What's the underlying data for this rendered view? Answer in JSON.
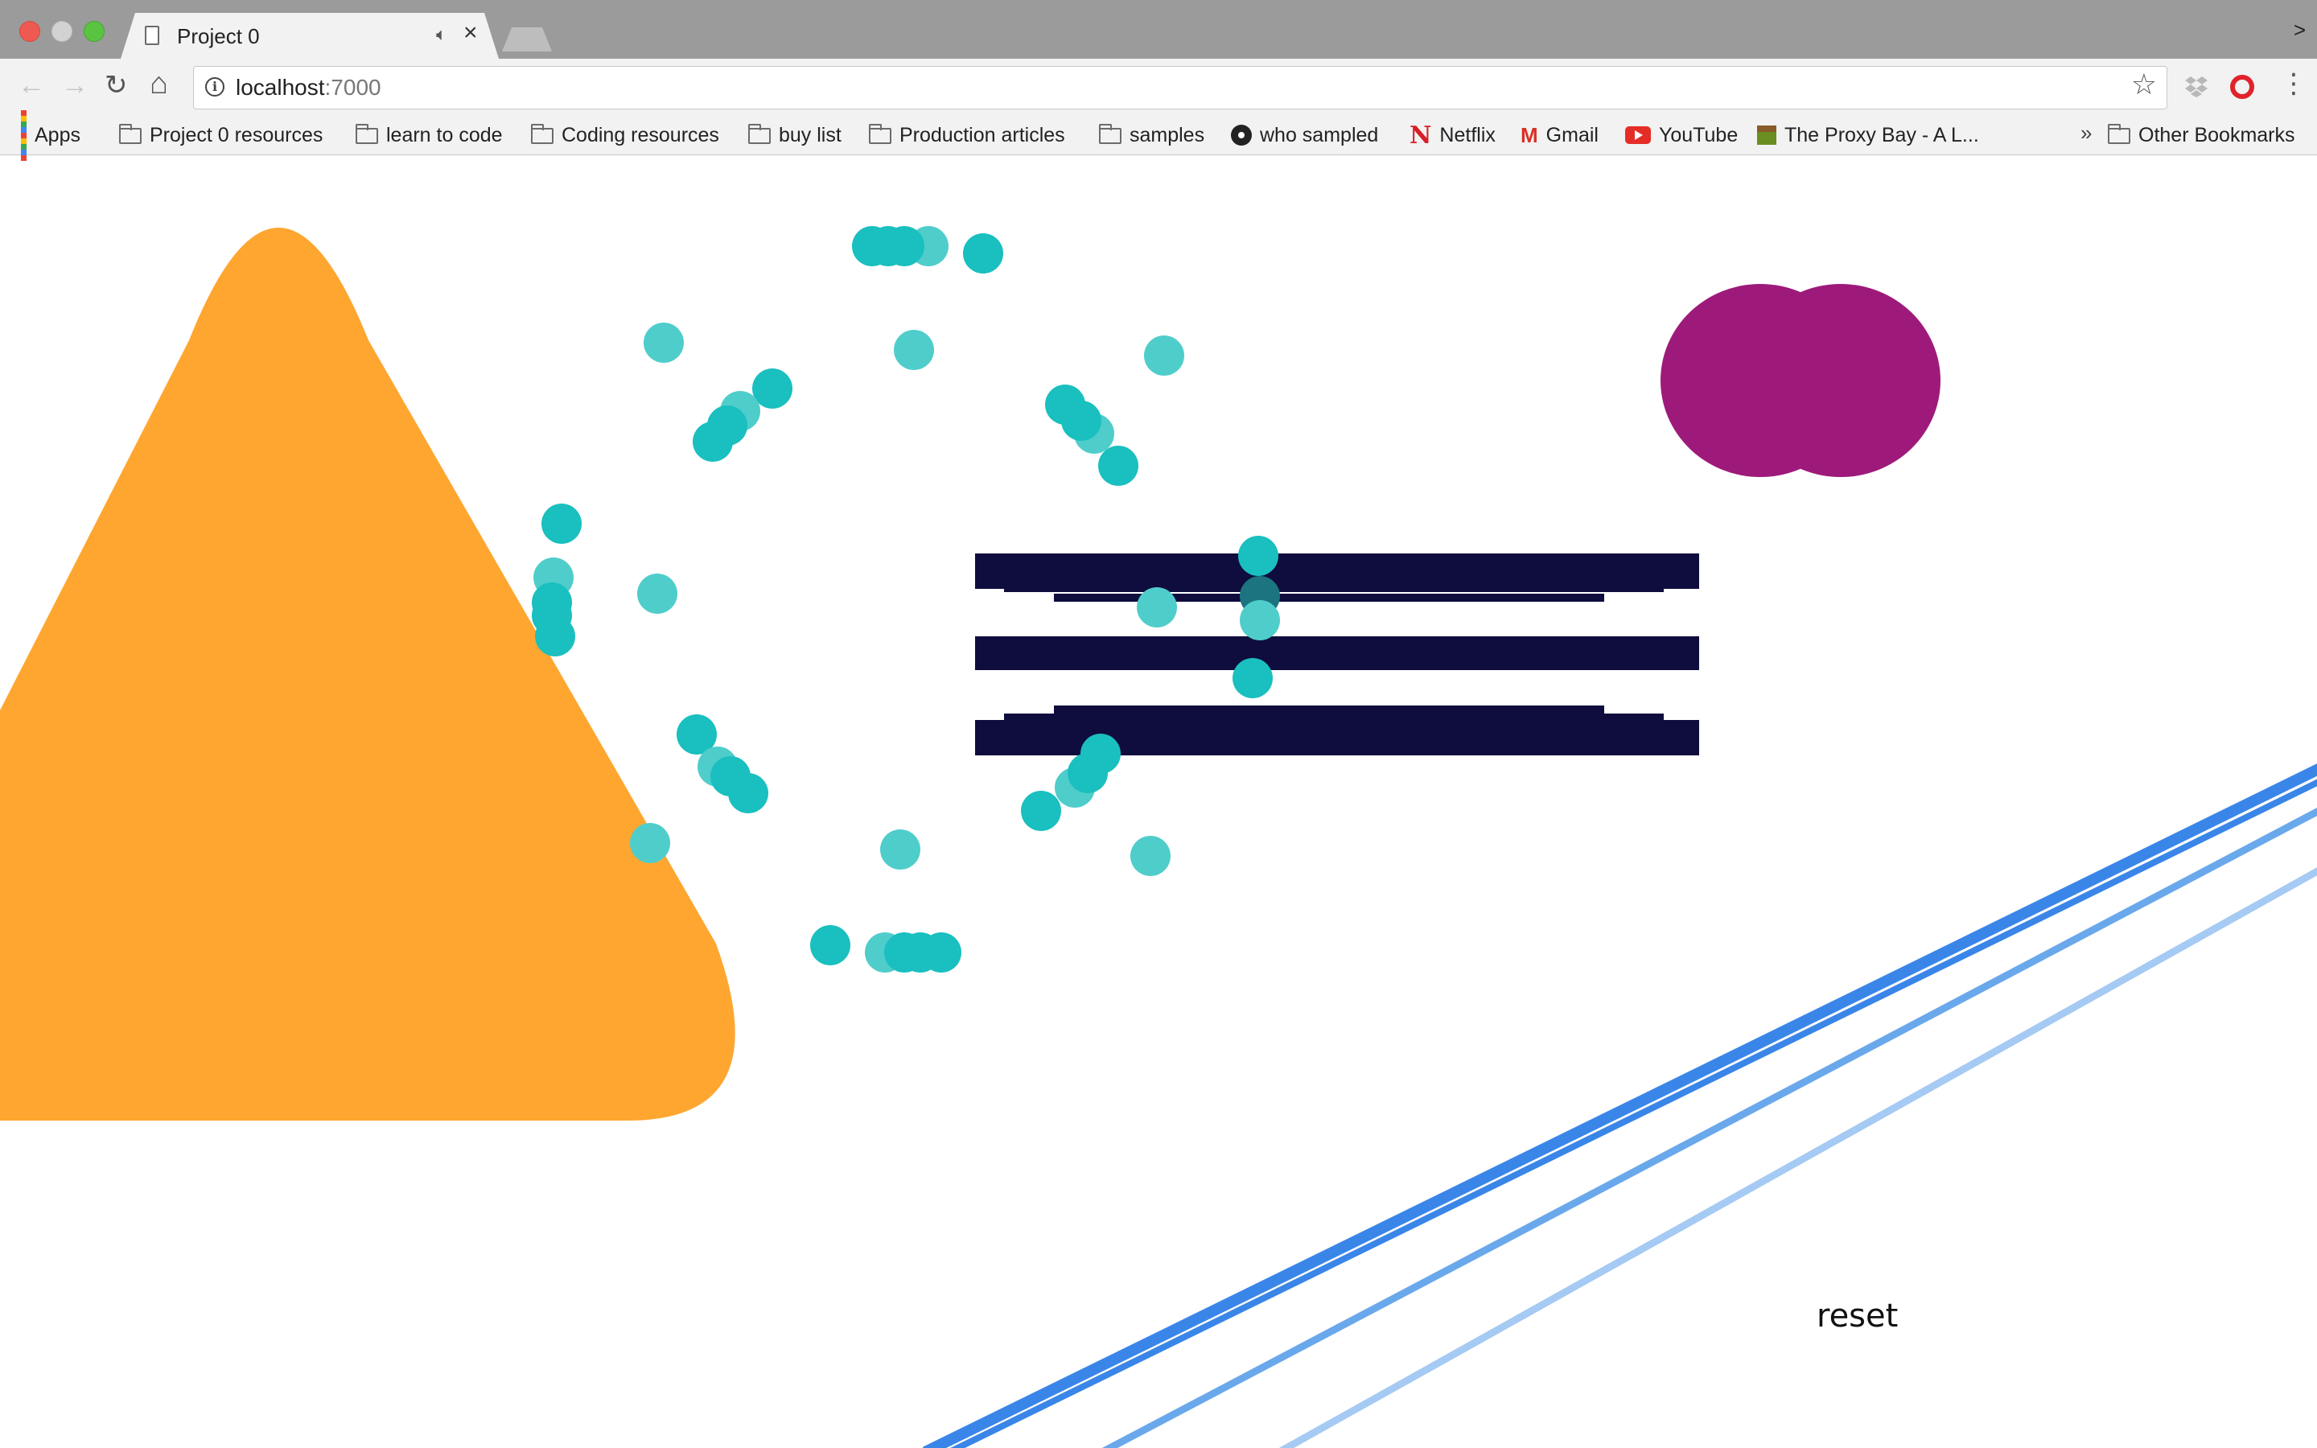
{
  "browser": {
    "tab": {
      "title": "Project 0",
      "audio_icon": "speaker-icon",
      "close_label": "×"
    },
    "tabstrip_more": ">",
    "address": {
      "host": "localhost",
      "port": ":7000"
    },
    "bookmarks": [
      {
        "label": "Apps",
        "icon": "apps-grid-icon"
      },
      {
        "label": "Project 0 resources",
        "icon": "folder-icon"
      },
      {
        "label": "learn to code",
        "icon": "folder-icon"
      },
      {
        "label": "Coding resources",
        "icon": "folder-icon"
      },
      {
        "label": "buy list",
        "icon": "folder-icon"
      },
      {
        "label": "Production articles",
        "icon": "folder-icon"
      },
      {
        "label": "samples",
        "icon": "folder-icon"
      },
      {
        "label": "who sampled",
        "icon": "vinyl-icon"
      },
      {
        "label": "Netflix",
        "icon": "netflix-icon"
      },
      {
        "label": "Gmail",
        "icon": "gmail-icon"
      },
      {
        "label": "YouTube",
        "icon": "youtube-icon"
      },
      {
        "label": "The Proxy Bay - A L...",
        "icon": "minecraft-block-icon"
      }
    ],
    "bookmarks_overflow": "»",
    "other_bookmarks": "Other Bookmarks",
    "glyphs": {
      "netflix": "N",
      "gmail": "M",
      "info": "i",
      "star": "☆",
      "menu": "⋮",
      "back": "←",
      "forward": "→",
      "reload": "↻",
      "home": "⌂"
    }
  },
  "page": {
    "reset_label": "reset",
    "colors": {
      "triangle": "#ffa630",
      "circles": "#1abfbf",
      "circles_faded": "#4fcdcb",
      "blob": "#9e1a7a",
      "bars": "#0f0d3d",
      "line_dark": "#3a86e8",
      "line_mid": "#6aa8ec",
      "line_light": "#a5caf3"
    }
  }
}
